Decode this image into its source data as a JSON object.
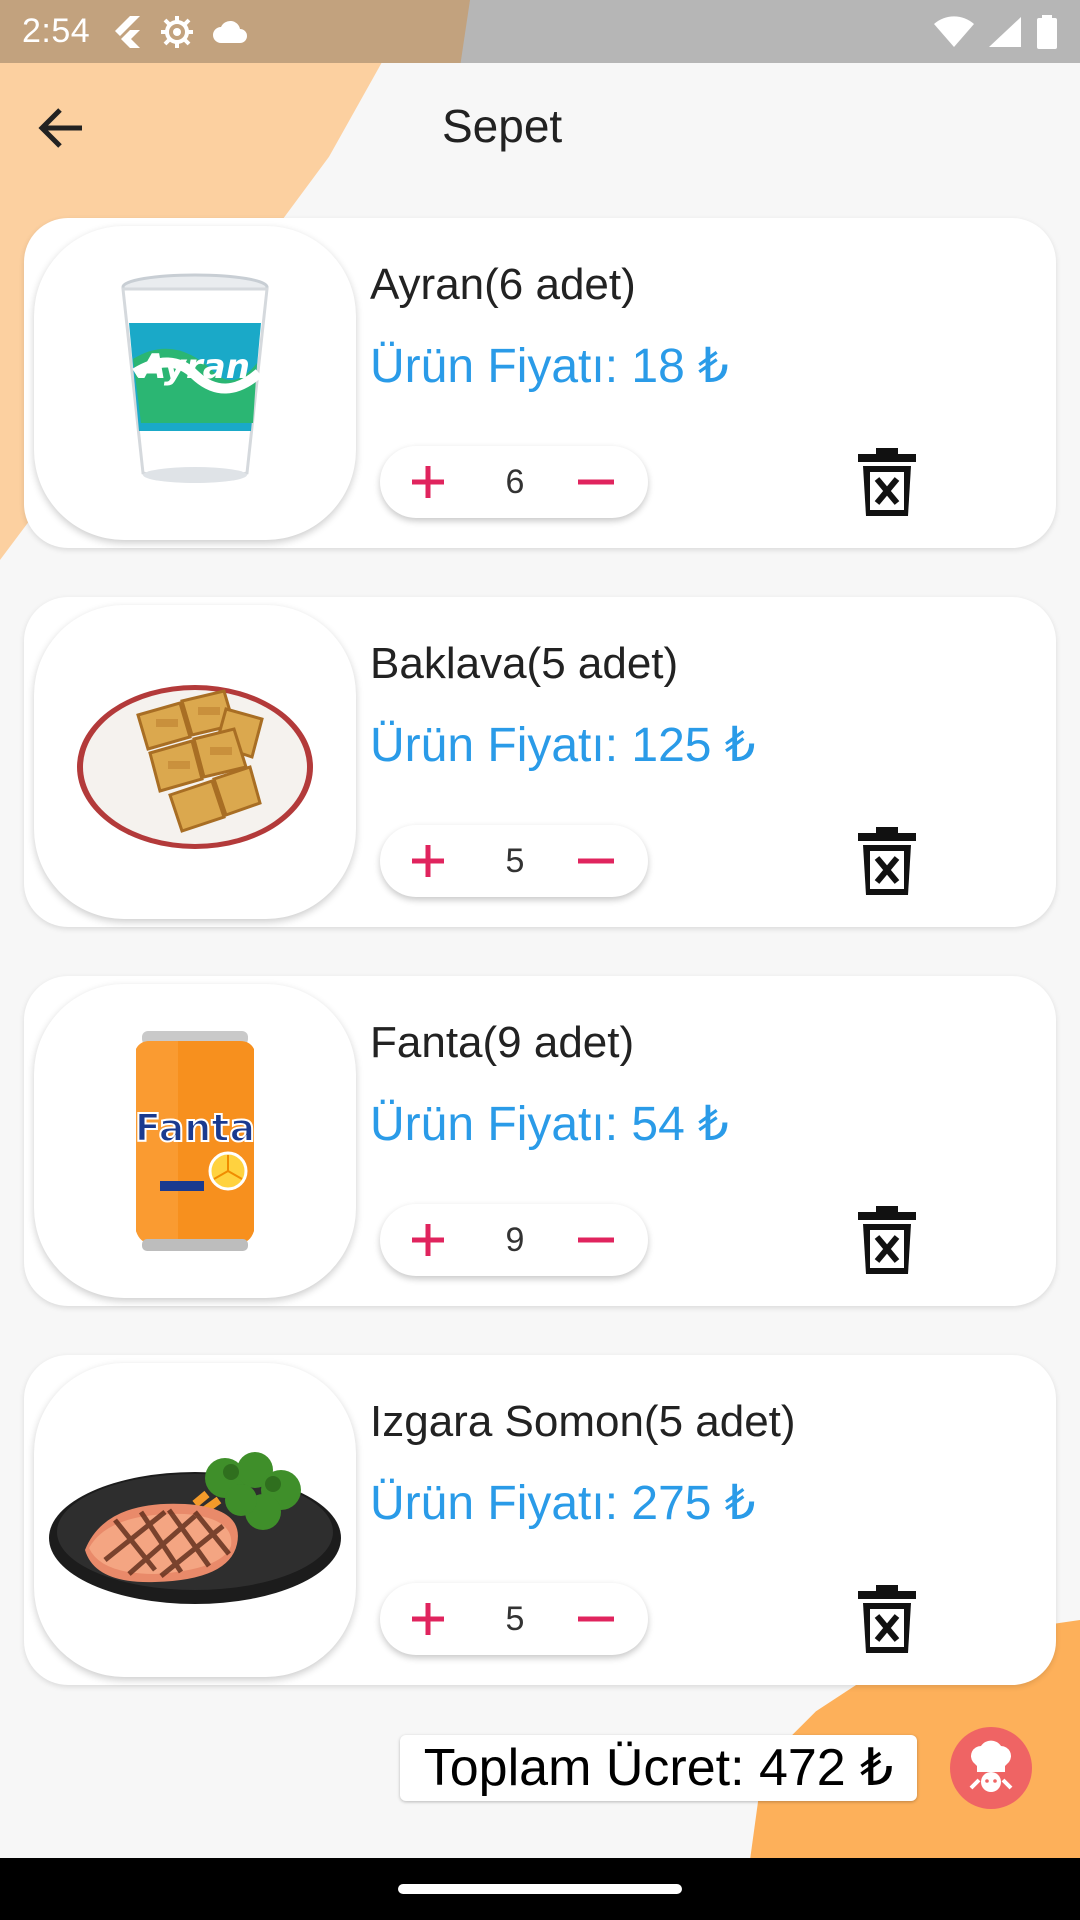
{
  "status_bar": {
    "time": "2:54",
    "left_icons": [
      "flutter-icon",
      "settings-icon",
      "cloud-icon"
    ],
    "right_icons": [
      "wifi-icon",
      "signal-icon",
      "battery-icon"
    ]
  },
  "app_bar": {
    "back_icon": "arrow-left-icon",
    "title": "Sepet"
  },
  "cart": {
    "items": [
      {
        "name": "Ayran(6 adet)",
        "price": "Ürün Fiyatı: 18 ₺",
        "quantity": "6",
        "image": "ayran-cup-image"
      },
      {
        "name": "Baklava(5 adet)",
        "price": "Ürün Fiyatı: 125 ₺",
        "quantity": "5",
        "image": "baklava-plate-image"
      },
      {
        "name": "Fanta(9 adet)",
        "price": "Ürün Fiyatı: 54 ₺",
        "quantity": "9",
        "image": "fanta-can-image"
      },
      {
        "name": "Izgara Somon(5 adet)",
        "price": "Ürün Fiyatı: 275 ₺",
        "quantity": "5",
        "image": "grilled-salmon-image"
      }
    ]
  },
  "footer": {
    "total": "Toplam Ücret: 472 ₺"
  },
  "colors": {
    "price": "#2a9be8",
    "stepper_icon": "#e0245e",
    "accent_orange": "#fdb05a",
    "accent_peach": "#fcd0a0",
    "chef_badge": "#ef6464"
  }
}
